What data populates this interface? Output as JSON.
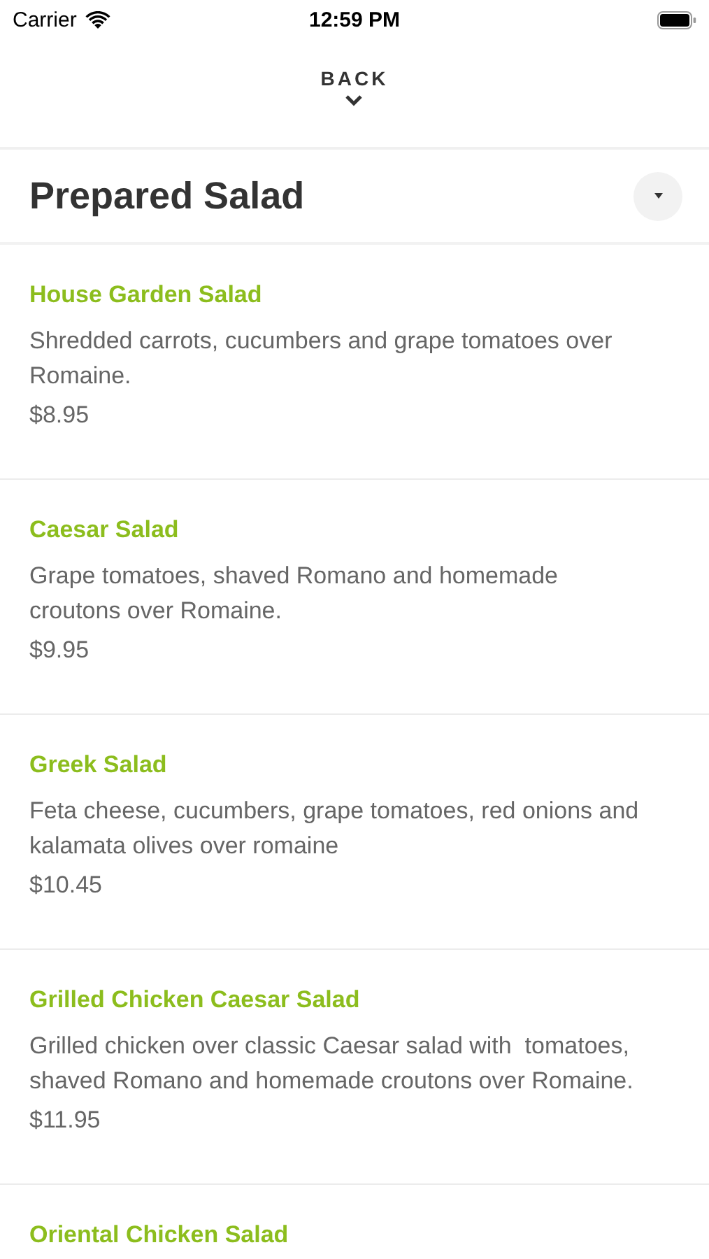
{
  "status_bar": {
    "carrier": "Carrier",
    "time": "12:59 PM"
  },
  "nav": {
    "back_label": "BACK"
  },
  "section": {
    "title": "Prepared Salad",
    "expanded": false
  },
  "items": [
    {
      "name": "House Garden Salad",
      "description": "Shredded carrots, cucumbers and grape tomatoes over Romaine.",
      "price": "$8.95"
    },
    {
      "name": "Caesar Salad",
      "description": "Grape tomatoes, shaved Romano and homemade croutons over Romaine.",
      "price": "$9.95"
    },
    {
      "name": "Greek Salad",
      "description": "Feta cheese, cucumbers, grape tomatoes, red onions and kalamata olives over romaine",
      "price": "$10.45"
    },
    {
      "name": "Grilled Chicken Caesar Salad",
      "description": "Grilled chicken over classic Caesar salad with  tomatoes, shaved Romano and homemade croutons over Romaine.",
      "price": "$11.95"
    },
    {
      "name": "Oriental Chicken Salad"
    }
  ]
}
